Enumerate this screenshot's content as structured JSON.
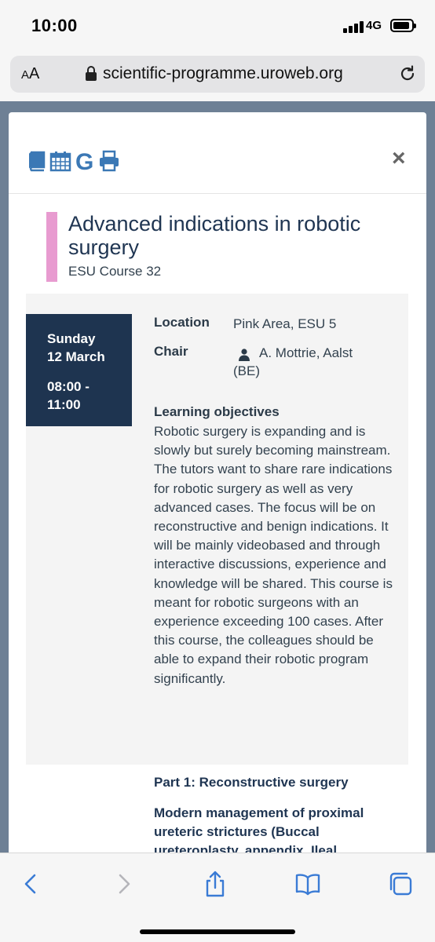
{
  "status_bar": {
    "time": "10:00",
    "network": "4G"
  },
  "browser": {
    "text_size_label_small": "A",
    "text_size_label_large": "A",
    "url": "scientific-programme.uroweb.org"
  },
  "modal": {
    "close_label": "×",
    "title": "Advanced indications in robotic surgery",
    "subtitle": "ESU Course 32",
    "accent_color": "#e89bd0",
    "date": {
      "day": "Sunday",
      "date": "12 March",
      "time": "08:00 - 11:00"
    },
    "location_label": "Location",
    "location_value": "Pink Area, ESU 5",
    "chair_label": "Chair",
    "chair_value": "A. Mottrie, Aalst (BE)",
    "objectives_title": "Learning objectives",
    "objectives_text": "Robotic surgery is expanding and is slowly but surely becoming mainstream.  The tutors want to share rare indications for robotic surgery as well as very advanced cases.  The focus will be on reconstructive and benign indications.  It will be mainly videobased and through interactive discussions, experience and knowledge will be shared.  This course is meant for robotic surgeons with an experience exceeding 100 cases.  After this course, the colleagues should be able to expand their robotic program significantly.",
    "part_title": "Part 1: Reconstructive surgery",
    "session_title": "Modern management of proximal ureteric strictures (Buccal ureteroplasty, appendix, Ileal"
  },
  "icons": {
    "tool_1": "book-icon",
    "tool_2": "calendar-icon",
    "tool_3": "google-icon",
    "tool_4": "print-icon"
  },
  "colors": {
    "brand_blue": "#3b78b5",
    "navy": "#1e3450"
  }
}
